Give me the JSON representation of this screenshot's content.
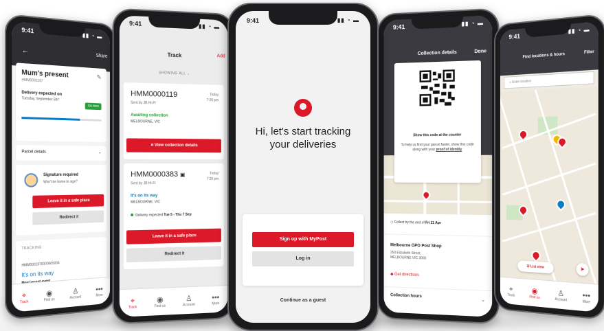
{
  "status_time": "9:41",
  "tabs": [
    {
      "label": "Track",
      "icon": "track-icon"
    },
    {
      "label": "Find us",
      "icon": "map-pin-icon"
    },
    {
      "label": "Account",
      "icon": "account-icon"
    },
    {
      "label": "More",
      "icon": "more-icon"
    }
  ],
  "parcel_detail": {
    "share_label": "Share",
    "title": "Mum's present",
    "code": "HMM0000197",
    "expected_label": "Delivery expected on",
    "expected_date": "Tuesday, September 5th*",
    "status_badge": "On time",
    "progress": 0.72,
    "parcel_details_label": "Parcel details",
    "signature_title": "Signature required",
    "signature_sub": "Won't be home to sign?",
    "safe_place_button": "Leave it in a safe place",
    "redirect_button": "Redirect it",
    "tracking_label": "TRACKING",
    "tracking_code": "HMM0001970000605004",
    "tracking_status": "It's on its way",
    "recent_event_label": "Most recent event"
  },
  "track_list": {
    "title": "Track",
    "add_label": "Add",
    "filter_label": "SHOWING ALL",
    "items": [
      {
        "id": "HMM0000119",
        "when_day": "Today",
        "when_time": "7:20 pm",
        "sender": "Sent by JB Hi-Fi",
        "status": "Awaiting collection",
        "status_color": "#2a9d3c",
        "location": "MELBOURNE, VIC",
        "button": "View collection details"
      },
      {
        "id": "HMM0000383",
        "when_day": "Today",
        "when_time": "7:20 pm",
        "sender": "Sent by JB Hi-Fi",
        "status": "It's on its way",
        "status_color": "#0a7cc2",
        "location": "MELBOURNE, VIC",
        "delivery_prefix": "Delivery expected ",
        "delivery_range": "Tue 5 - Thu 7 Sep",
        "button1": "Leave it in a safe place",
        "button2": "Redirect it"
      }
    ]
  },
  "welcome": {
    "headline_line1": "Hi, let's start tracking",
    "headline_line2": "your deliveries",
    "signup_button": "Sign up with MyPost",
    "login_button": "Log in",
    "guest_link": "Continue as a guest"
  },
  "collection": {
    "title": "Collection details",
    "done_label": "Done",
    "qr_title": "Show this code at the counter",
    "qr_desc": "To help us find your parcel faster, show this code along with your",
    "qr_link": "proof of identity",
    "collect_prefix": "Collect by the end of ",
    "collect_date": "Fri 21 Apr",
    "shop_name": "Melbourne GPO Post Shop",
    "address_line1": "250 Elizabeth Street,",
    "address_line2": "MELBOURNE VIC 3000",
    "directions": "Get directions",
    "hours_label": "Collection hours"
  },
  "locations": {
    "title": "Find locations & hours",
    "filter_label": "Filter",
    "search_placeholder": "Enter location",
    "list_view": "List view"
  },
  "colors": {
    "brand_red": "#dc1928",
    "success_green": "#2a9d3c",
    "info_blue": "#0a7cc2",
    "dark_header": "#3a3a40"
  }
}
